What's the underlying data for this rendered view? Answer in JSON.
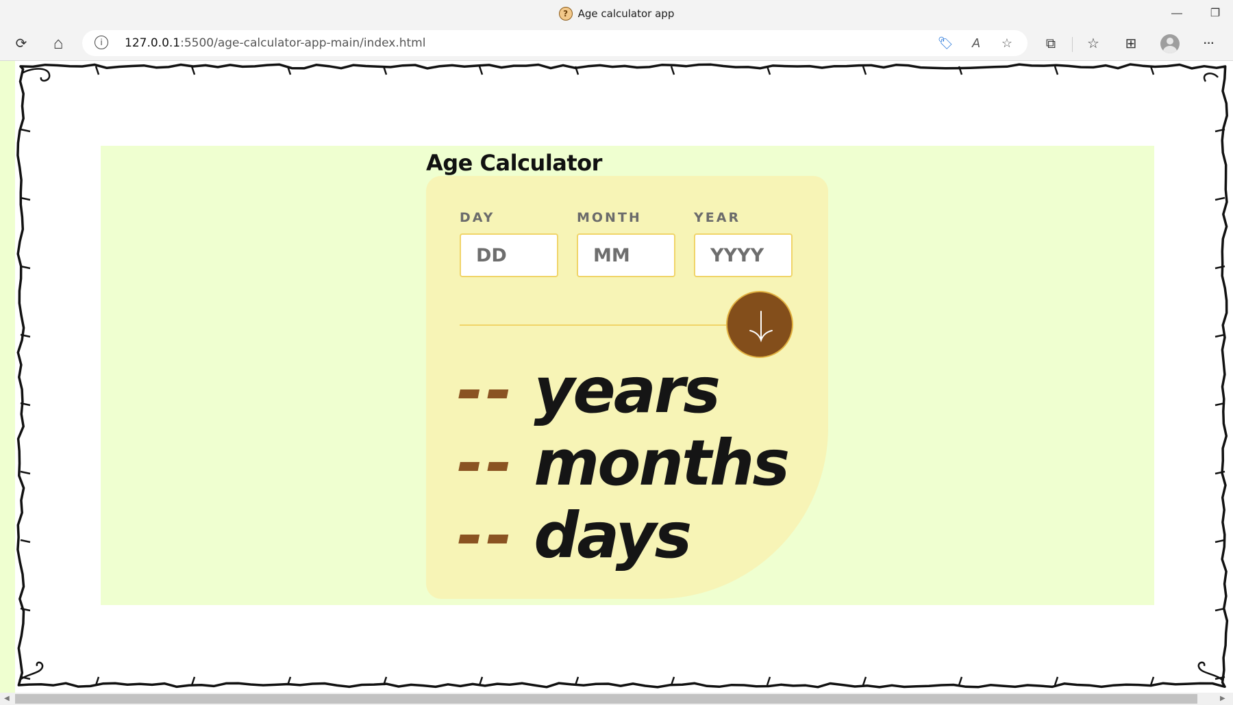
{
  "window": {
    "title": "Age calculator app",
    "favicon_glyph": "?",
    "minimize_glyph": "—",
    "restore_glyph": "❐"
  },
  "toolbar": {
    "refresh_icon": "⟳",
    "home_icon": "⌂",
    "info_glyph": "i",
    "url_host": "127.0.0.1",
    "url_rest": ":5500/age-calculator-app-main/index.html",
    "tag_icon": "🏷",
    "read_aloud_icon": "A",
    "favorite_add_icon": "☆",
    "extensions_icon": "⧉",
    "favorites_icon": "☆",
    "collections_icon": "⊞",
    "more_icon": "···"
  },
  "app": {
    "title": "Age Calculator",
    "day_label": "DAY",
    "day_placeholder": "DD",
    "month_label": "MONTH",
    "month_placeholder": "MM",
    "year_label": "YEAR",
    "year_placeholder": "YYYY",
    "results": [
      {
        "value": "--",
        "unit": "years"
      },
      {
        "value": "--",
        "unit": "months"
      },
      {
        "value": "--",
        "unit": "days"
      }
    ]
  },
  "colors": {
    "page_bg": "#efffd0",
    "card_bg": "#f7f4b6",
    "accent_brown": "#834e1b",
    "input_border": "#f0d468",
    "dash_color": "#8a5322"
  }
}
